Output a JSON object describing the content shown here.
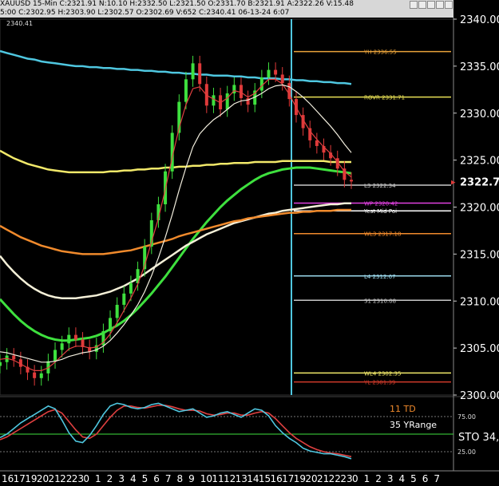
{
  "window": {
    "symbol_line": "XAUUSD 15-Min C:2321.91 N:10.10 H:2332.50 L:2321.50 O:2331.70 B:2321.91 A:2322.26 V:15.48",
    "ohlc_line": "5:00 C:2302.95 H:2303.90 L:2302.57 O:2302.69 V:652 C:2340.41 06-13-24 6:07",
    "toolbar_icons": [
      "minimize-icon",
      "maximize-icon",
      "close-icon",
      "menu-icon",
      "pin-icon",
      "settings-icon"
    ]
  },
  "chart_data": {
    "type": "line",
    "instrument": "XAUUSD",
    "timeframe": "15-Min",
    "ylim": [
      2300,
      2340
    ],
    "y_ticks": [
      "2340.00",
      "2335.00",
      "2330.00",
      "2325.00",
      "2320.00",
      "2315.00",
      "2310.00",
      "2305.00",
      "2300.00"
    ],
    "last_price_label": "2322.73",
    "top_left_price": "2340.41",
    "x_tick_labels": [
      "16",
      "17",
      "19",
      "20",
      "21",
      "22",
      "23",
      "0",
      "1",
      "2",
      "3",
      "4",
      "5",
      "6",
      "7",
      "8",
      "9",
      "10",
      "11",
      "12",
      "13",
      "14",
      "15",
      "16",
      "17",
      "19",
      "20",
      "21",
      "22",
      "23",
      "0",
      "1",
      "2",
      "3",
      "4",
      "5",
      "6",
      "7"
    ],
    "price_series": [
      {
        "name": "candles_close",
        "values": [
          2303.5,
          2304.2,
          2303.8,
          2303.0,
          2302.4,
          2301.8,
          2302.3,
          2303.6,
          2304.8,
          2305.5,
          2306.4,
          2305.9,
          2305.1,
          2304.6,
          2305.3,
          2306.8,
          2308.2,
          2309.6,
          2310.8,
          2311.9,
          2313.4,
          2315.8,
          2318.6,
          2320.3,
          2323.8,
          2327.9,
          2331.2,
          2333.6,
          2335.3,
          2333.1,
          2330.8,
          2331.9,
          2330.4,
          2332.1,
          2333.0,
          2331.6,
          2330.9,
          2332.4,
          2333.8,
          2334.6,
          2334.1,
          2333.2,
          2331.5,
          2329.8,
          2328.4,
          2327.1,
          2326.5,
          2325.8,
          2325.2,
          2324.1,
          2322.9,
          2322.73
        ]
      },
      {
        "name": "fast_ma",
        "values": [
          2303.8,
          2303.9,
          2303.7,
          2303.3,
          2302.9,
          2302.6,
          2302.6,
          2302.9,
          2303.5,
          2304.2,
          2304.9,
          2305.2,
          2305.2,
          2305.0,
          2305.1,
          2305.6,
          2306.5,
          2307.7,
          2309.0,
          2310.3,
          2311.8,
          2313.8,
          2316.3,
          2318.8,
          2321.9,
          2325.3,
          2328.4,
          2330.9,
          2332.6,
          2332.8,
          2331.9,
          2331.5,
          2331.1,
          2331.6,
          2332.4,
          2332.2,
          2331.7,
          2332.1,
          2332.9,
          2333.6,
          2333.6,
          2333.1,
          2332.0,
          2330.6,
          2329.3,
          2328.1,
          2327.2,
          2326.4,
          2325.7,
          2324.8,
          2323.8,
          2323.2
        ]
      },
      {
        "name": "slow_ma",
        "values": [
          2304.6,
          2304.5,
          2304.3,
          2304.1,
          2303.9,
          2303.7,
          2303.5,
          2303.5,
          2303.6,
          2303.8,
          2304.1,
          2304.3,
          2304.5,
          2304.6,
          2304.8,
          2305.2,
          2305.8,
          2306.6,
          2307.5,
          2308.5,
          2309.6,
          2311.0,
          2312.7,
          2314.6,
          2316.8,
          2319.2,
          2321.8,
          2324.2,
          2326.4,
          2327.8,
          2328.6,
          2329.3,
          2329.8,
          2330.4,
          2331.0,
          2331.3,
          2331.4,
          2331.7,
          2332.1,
          2332.6,
          2332.9,
          2333.0,
          2332.8,
          2332.3,
          2331.7,
          2331.0,
          2330.2,
          2329.4,
          2328.6,
          2327.7,
          2326.7,
          2325.8
        ]
      }
    ],
    "moving_averages": [
      {
        "name": "green_ma",
        "color": "#3ee03e",
        "values": [
          2310.2,
          2309.4,
          2308.6,
          2307.9,
          2307.3,
          2306.8,
          2306.4,
          2306.1,
          2305.9,
          2305.8,
          2305.8,
          2305.9,
          2306.0,
          2306.1,
          2306.3,
          2306.6,
          2307.0,
          2307.4,
          2307.9,
          2308.5,
          2309.2,
          2310.0,
          2310.8,
          2311.7,
          2312.6,
          2313.6,
          2314.6,
          2315.6,
          2316.6,
          2317.5,
          2318.4,
          2319.2,
          2320.0,
          2320.7,
          2321.3,
          2321.9,
          2322.4,
          2322.9,
          2323.3,
          2323.6,
          2323.8,
          2324.0,
          2324.1,
          2324.2,
          2324.2,
          2324.2,
          2324.1,
          2324.0,
          2323.9,
          2323.8,
          2323.7,
          2323.6
        ]
      },
      {
        "name": "cream_ma",
        "color": "#f5f0d8",
        "values": [
          2314.8,
          2313.9,
          2313.1,
          2312.4,
          2311.8,
          2311.3,
          2310.9,
          2310.6,
          2310.4,
          2310.3,
          2310.3,
          2310.3,
          2310.4,
          2310.5,
          2310.6,
          2310.8,
          2311.0,
          2311.3,
          2311.6,
          2312.0,
          2312.4,
          2312.9,
          2313.4,
          2313.9,
          2314.4,
          2314.9,
          2315.4,
          2315.9,
          2316.3,
          2316.7,
          2317.1,
          2317.4,
          2317.7,
          2318.0,
          2318.3,
          2318.5,
          2318.7,
          2318.9,
          2319.1,
          2319.3,
          2319.4,
          2319.6,
          2319.7,
          2319.8,
          2319.9,
          2320.0,
          2320.1,
          2320.2,
          2320.3,
          2320.3,
          2320.4,
          2320.4
        ]
      },
      {
        "name": "orange_ma",
        "color": "#f08a2c",
        "values": [
          2318.0,
          2317.6,
          2317.2,
          2316.8,
          2316.5,
          2316.2,
          2315.9,
          2315.7,
          2315.5,
          2315.3,
          2315.2,
          2315.1,
          2315.0,
          2315.0,
          2315.0,
          2315.0,
          2315.1,
          2315.2,
          2315.3,
          2315.4,
          2315.6,
          2315.8,
          2316.0,
          2316.2,
          2316.4,
          2316.6,
          2316.9,
          2317.1,
          2317.3,
          2317.5,
          2317.7,
          2317.9,
          2318.1,
          2318.3,
          2318.5,
          2318.6,
          2318.8,
          2318.9,
          2319.0,
          2319.1,
          2319.2,
          2319.3,
          2319.4,
          2319.4,
          2319.5,
          2319.5,
          2319.6,
          2319.6,
          2319.6,
          2319.7,
          2319.7,
          2319.7
        ]
      },
      {
        "name": "yellow_ma",
        "color": "#f2e96a",
        "values": [
          2326.0,
          2325.6,
          2325.2,
          2324.9,
          2324.6,
          2324.4,
          2324.2,
          2324.0,
          2323.9,
          2323.8,
          2323.7,
          2323.7,
          2323.7,
          2323.7,
          2323.7,
          2323.7,
          2323.8,
          2323.8,
          2323.9,
          2323.9,
          2324.0,
          2324.0,
          2324.1,
          2324.1,
          2324.2,
          2324.2,
          2324.3,
          2324.3,
          2324.4,
          2324.4,
          2324.5,
          2324.5,
          2324.6,
          2324.6,
          2324.7,
          2324.7,
          2324.7,
          2324.8,
          2324.8,
          2324.8,
          2324.8,
          2324.9,
          2324.9,
          2324.9,
          2324.9,
          2324.9,
          2324.9,
          2324.9,
          2324.8,
          2324.8,
          2324.8,
          2324.8
        ]
      },
      {
        "name": "cyan_ma",
        "color": "#4fc7e0",
        "values": [
          2336.6,
          2336.4,
          2336.2,
          2336.0,
          2335.8,
          2335.7,
          2335.5,
          2335.4,
          2335.3,
          2335.2,
          2335.1,
          2335.0,
          2335.0,
          2334.9,
          2334.9,
          2334.8,
          2334.8,
          2334.7,
          2334.7,
          2334.6,
          2334.6,
          2334.5,
          2334.5,
          2334.4,
          2334.4,
          2334.3,
          2334.3,
          2334.2,
          2334.2,
          2334.1,
          2334.1,
          2334.0,
          2334.0,
          2334.0,
          2333.9,
          2333.9,
          2333.8,
          2333.8,
          2333.7,
          2333.7,
          2333.7,
          2333.6,
          2333.6,
          2333.5,
          2333.5,
          2333.4,
          2333.4,
          2333.3,
          2333.3,
          2333.2,
          2333.2,
          2333.1
        ]
      }
    ],
    "levels": [
      {
        "label": "YH 2336.55",
        "value": 2336.55,
        "color": "#e8a23a"
      },
      {
        "label": "ROVR 2331.71",
        "value": 2331.71,
        "color": "#e8e055"
      },
      {
        "label": "L3 2322.34",
        "value": 2322.34,
        "color": "#c8c8c8"
      },
      {
        "label": "WP 2320.42",
        "value": 2320.42,
        "color": "#e040e0"
      },
      {
        "label": "Yest Mid Poi",
        "value": 2319.6,
        "color": "#ffffff"
      },
      {
        "label": "WL3 2317.18",
        "value": 2317.18,
        "color": "#f08a2c"
      },
      {
        "label": "L4 2312.67",
        "value": 2312.67,
        "color": "#9ad7ea"
      },
      {
        "label": "S1 2310.08",
        "value": 2310.08,
        "color": "#c8c8c8"
      },
      {
        "label": "WL4 2302.35",
        "value": 2302.35,
        "color": "#f2e96a"
      },
      {
        "label": "YL 2301.39",
        "value": 2301.39,
        "color": "#d03a2a"
      }
    ],
    "stochastic": {
      "label": "STO 34,",
      "td_label": "11 TD",
      "yrange_label": "35 YRange",
      "ticks": [
        "75.00",
        "25.00"
      ],
      "k_values": [
        45,
        50,
        58,
        66,
        72,
        78,
        84,
        90,
        86,
        70,
        52,
        40,
        38,
        48,
        62,
        78,
        90,
        94,
        92,
        88,
        86,
        88,
        92,
        94,
        90,
        86,
        82,
        84,
        86,
        80,
        74,
        76,
        80,
        82,
        78,
        74,
        80,
        86,
        84,
        76,
        62,
        52,
        44,
        38,
        30,
        26,
        24,
        22,
        22,
        20,
        18,
        15
      ],
      "d_values": [
        42,
        46,
        52,
        58,
        64,
        70,
        76,
        82,
        85,
        80,
        68,
        56,
        46,
        44,
        50,
        62,
        74,
        84,
        90,
        90,
        88,
        87,
        89,
        91,
        91,
        89,
        86,
        84,
        84,
        83,
        79,
        77,
        78,
        80,
        80,
        77,
        77,
        80,
        82,
        80,
        72,
        62,
        52,
        44,
        38,
        32,
        28,
        25,
        23,
        22,
        20,
        18
      ]
    }
  }
}
